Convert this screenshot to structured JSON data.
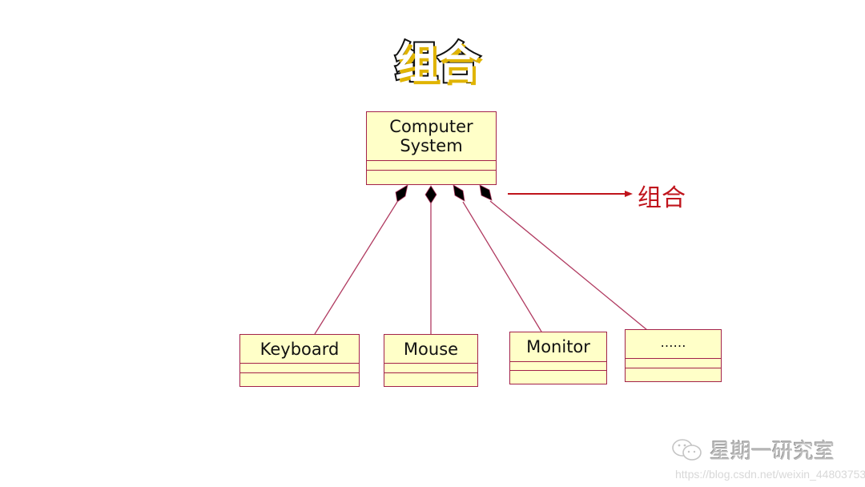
{
  "slide": {
    "title": "组合",
    "annotation": "组合"
  },
  "diagram": {
    "whole": {
      "name": "Computer\nSystem",
      "line1": "Computer",
      "line2": "System"
    },
    "parts": [
      {
        "name": "Keyboard"
      },
      {
        "name": "Mouse"
      },
      {
        "name": "Monitor"
      },
      {
        "name": "……"
      }
    ],
    "relationship": "composition",
    "colors": {
      "box_fill": "#ffffc8",
      "box_border": "#a3224a",
      "connector": "#b03a60",
      "diamond": "#000000",
      "annotation": "#c0141c"
    }
  },
  "watermark": {
    "icon": "wechat-icon",
    "text": "星期一研究室",
    "url": "https://blog.csdn.net/weixin_44803753"
  }
}
